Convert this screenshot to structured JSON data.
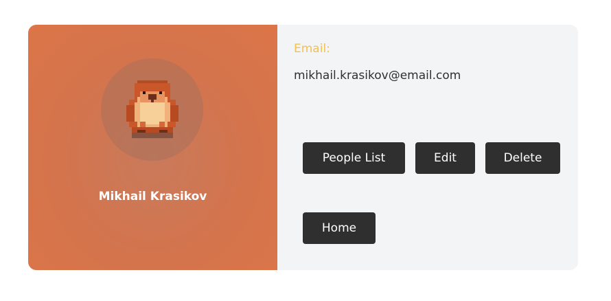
{
  "profile": {
    "name": "Mikhail Krasikov",
    "avatar_icon": "pixel-hamster-icon",
    "panel_color": "#d9764c"
  },
  "details": {
    "email_label": "Email:",
    "email_value": "mikhail.krasikov@email.com",
    "label_color": "#f2c14e"
  },
  "actions": {
    "people_list_label": "People List",
    "edit_label": "Edit",
    "delete_label": "Delete",
    "home_label": "Home",
    "button_color": "#2f2f2f"
  }
}
